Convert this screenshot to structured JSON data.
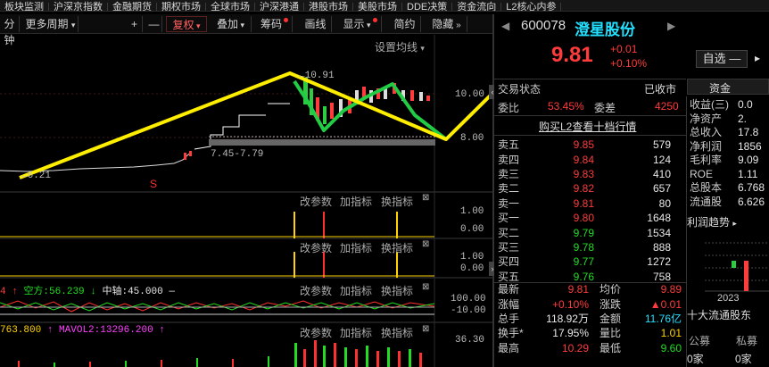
{
  "top_menu": [
    "板块监测",
    "沪深京指数",
    "金融期货",
    "期权市场",
    "全球市场",
    "沪深港通",
    "港股市场",
    "美股市场",
    "DDE决策",
    "资金流向",
    "L2核心内参"
  ],
  "toolbar": {
    "period_tab": "分钟",
    "more_periods": "更多周期",
    "plus": "+",
    "minus": "—",
    "restore": "复权",
    "overlay": "叠加",
    "chips": "筹码",
    "draw": "画线",
    "display": "显示",
    "simplified": "简约",
    "hide": "隐藏"
  },
  "main_chart": {
    "settings_label": "设置均线",
    "high_label": "10.91",
    "low_label": "6.21",
    "range_label": "7.45-7.79",
    "marker": "S",
    "y_ticks": [
      "10.00",
      "8.00"
    ]
  },
  "indicator_panels": [
    {
      "buttons": [
        "改参数",
        "加指标",
        "换指标"
      ],
      "y_ticks": [
        "1.00",
        "0.00"
      ]
    },
    {
      "buttons": [
        "改参数",
        "加指标",
        "换指标"
      ],
      "y_ticks": [
        "1.00",
        "0.00"
      ]
    },
    {
      "legend": [
        {
          "text": "4",
          "color": "#ff4040"
        },
        {
          "text": "空方:56.239",
          "color": "#22dd22"
        },
        {
          "text": "中轴:45.000",
          "color": "#dddddd"
        }
      ],
      "buttons": [
        "改参数",
        "加指标",
        "换指标"
      ],
      "y_ticks": [
        "100.00",
        "-10.00"
      ]
    },
    {
      "legend": [
        {
          "text": "763.800",
          "color": "#ffd400"
        },
        {
          "text": "MAVOL2:13296.200",
          "color": "#ff40ff"
        }
      ],
      "buttons": [
        "改参数",
        "加指标",
        "换指标"
      ],
      "y_ticks": [
        "36.30"
      ]
    }
  ],
  "quote": {
    "code": "600078",
    "name": "澄星股份",
    "price": "9.81",
    "change": "+0.01",
    "change_pct": "+0.10%",
    "watchlist_btn": "自选",
    "status_label": "交易状态",
    "status_value": "已收市",
    "fund_tab": "资金",
    "weibi_label": "委比",
    "weibi_value": "53.45%",
    "weicha_label": "委差",
    "weicha_value": "4250",
    "l2_link": "购买L2查看十档行情",
    "asks": [
      {
        "label": "卖五",
        "price": "9.85",
        "vol": "579"
      },
      {
        "label": "卖四",
        "price": "9.84",
        "vol": "124"
      },
      {
        "label": "卖三",
        "price": "9.83",
        "vol": "410"
      },
      {
        "label": "卖二",
        "price": "9.82",
        "vol": "657"
      },
      {
        "label": "卖一",
        "price": "9.81",
        "vol": "80"
      }
    ],
    "bids": [
      {
        "label": "买一",
        "price": "9.80",
        "vol": "1648"
      },
      {
        "label": "买二",
        "price": "9.79",
        "vol": "1534"
      },
      {
        "label": "买三",
        "price": "9.78",
        "vol": "888"
      },
      {
        "label": "买四",
        "price": "9.77",
        "vol": "1272"
      },
      {
        "label": "买五",
        "price": "9.76",
        "vol": "758"
      }
    ],
    "stats": [
      {
        "l1": "最新",
        "v1": "9.81",
        "c1": "#ff3b3b",
        "l2": "均价",
        "v2": "9.89",
        "c2": "#ff3b3b"
      },
      {
        "l1": "涨幅",
        "v1": "+0.10%",
        "c1": "#ff3b3b",
        "l2": "涨跌",
        "v2": "▲0.01",
        "c2": "#ff3b3b"
      },
      {
        "l1": "总手",
        "v1": "118.92万",
        "c1": "#e8e8e8",
        "l2": "金额",
        "v2": "11.76亿",
        "c2": "#22e0ff"
      },
      {
        "l1": "换手*",
        "v1": "17.95%",
        "c1": "#e8e8e8",
        "l2": "量比",
        "v2": "1.01",
        "c2": "#ffd400"
      },
      {
        "l1": "最高",
        "v1": "10.29",
        "c1": "#ff3b3b",
        "l2": "最低",
        "v2": "9.60",
        "c2": "#22dd22"
      }
    ],
    "fundamentals": [
      {
        "label": "收益(三)",
        "value": "0.0"
      },
      {
        "label": "净资产",
        "value": "2."
      },
      {
        "label": "总收入",
        "value": "17.8"
      },
      {
        "label": "净利润",
        "value": "1856"
      },
      {
        "label": "毛利率",
        "value": "9.09"
      },
      {
        "label": "ROE",
        "value": "1.11"
      },
      {
        "label": "总股本",
        "value": "6.768"
      },
      {
        "label": "流通股",
        "value": "6.626"
      }
    ],
    "profit_trend_label": "利润趋势",
    "profit_year": "2023",
    "top10_label": "十大流通股东",
    "public_fund": "公募",
    "private_fund": "私募",
    "public_count": "0家",
    "private_count": "0家"
  },
  "colors": {
    "up": "#ff3b3b",
    "down": "#22dd22",
    "accent": "#ffd400",
    "name": "#22e0ff",
    "drawing": "#ffee00"
  }
}
